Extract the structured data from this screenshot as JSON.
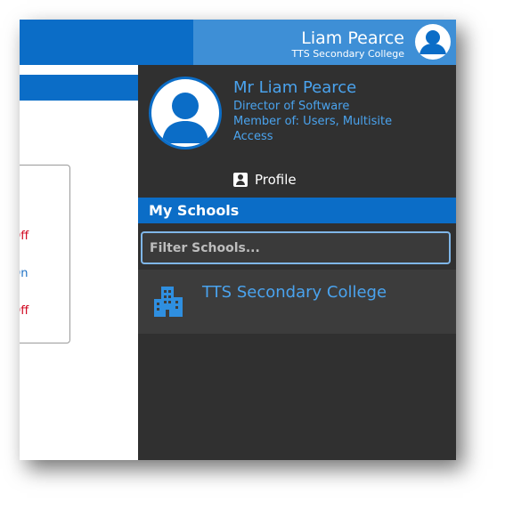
{
  "header": {
    "user_name": "Liam Pearce",
    "school": "TTS Secondary College"
  },
  "background": {
    "status_items": [
      "Off",
      "On",
      "Off"
    ]
  },
  "profile": {
    "name": "Mr Liam Pearce",
    "role": "Director of Software",
    "member_of": "Member of: Users, Multisite Access",
    "profile_link": "Profile"
  },
  "schools": {
    "title": "My Schools",
    "filter_placeholder": "Filter Schools...",
    "items": [
      "TTS Secondary College"
    ]
  },
  "colors": {
    "primary": "#0b6dc7",
    "header_accent": "#3e8fd6",
    "drawer_bg": "#303030",
    "link_blue": "#4aa3ee",
    "status_off": "#d0021b",
    "status_on": "#1a6fc4"
  },
  "icons": {
    "avatar": "user-avatar-icon",
    "profile": "contact-card-icon",
    "school": "building-icon"
  }
}
